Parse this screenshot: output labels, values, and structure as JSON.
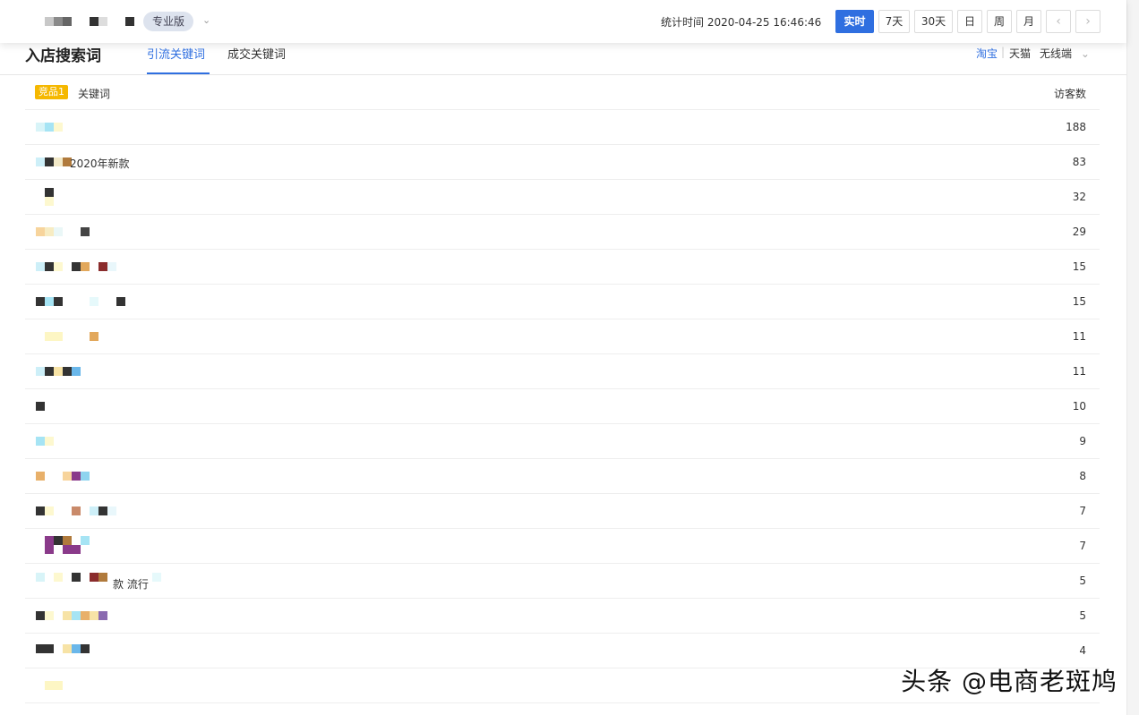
{
  "topbar": {
    "edition": "专业版",
    "stat_time": "统计时间 2020-04-25 16:46:46",
    "ranges": [
      "实时",
      "7天",
      "30天",
      "日",
      "周",
      "月"
    ],
    "active_range": "实时",
    "prev": "‹",
    "next": "›"
  },
  "section": {
    "title": "入店搜索词",
    "tabs": [
      "引流关键词",
      "成交关键词"
    ],
    "active_tab": "引流关键词",
    "platforms": [
      "淘宝",
      "天猫",
      "无线端"
    ],
    "platform_sep": "|",
    "active_platform": "淘宝"
  },
  "table": {
    "badge": "竞品1",
    "col_keyword": "关键词",
    "col_visitors": "访客数",
    "rows": [
      {
        "keyword": "",
        "visitors": "188"
      },
      {
        "keyword": "2020年新款",
        "visitors": "83"
      },
      {
        "keyword": "",
        "visitors": "32"
      },
      {
        "keyword": "",
        "visitors": "29"
      },
      {
        "keyword": "",
        "visitors": "15"
      },
      {
        "keyword": "",
        "visitors": "15"
      },
      {
        "keyword": "",
        "visitors": "11"
      },
      {
        "keyword": "",
        "visitors": "11"
      },
      {
        "keyword": "",
        "visitors": "10"
      },
      {
        "keyword": "",
        "visitors": "9"
      },
      {
        "keyword": "",
        "visitors": "8"
      },
      {
        "keyword": "",
        "visitors": "7"
      },
      {
        "keyword": "",
        "visitors": "7"
      },
      {
        "keyword": "款 流行",
        "visitors": "5"
      },
      {
        "keyword": "",
        "visitors": "5"
      },
      {
        "keyword": "",
        "visitors": "4"
      },
      {
        "keyword": "",
        "visitors": ""
      }
    ]
  },
  "watermark": "头条 @电商老斑鸠",
  "colors": {
    "accent": "#2f6fe0",
    "badge": "#f5b800"
  }
}
